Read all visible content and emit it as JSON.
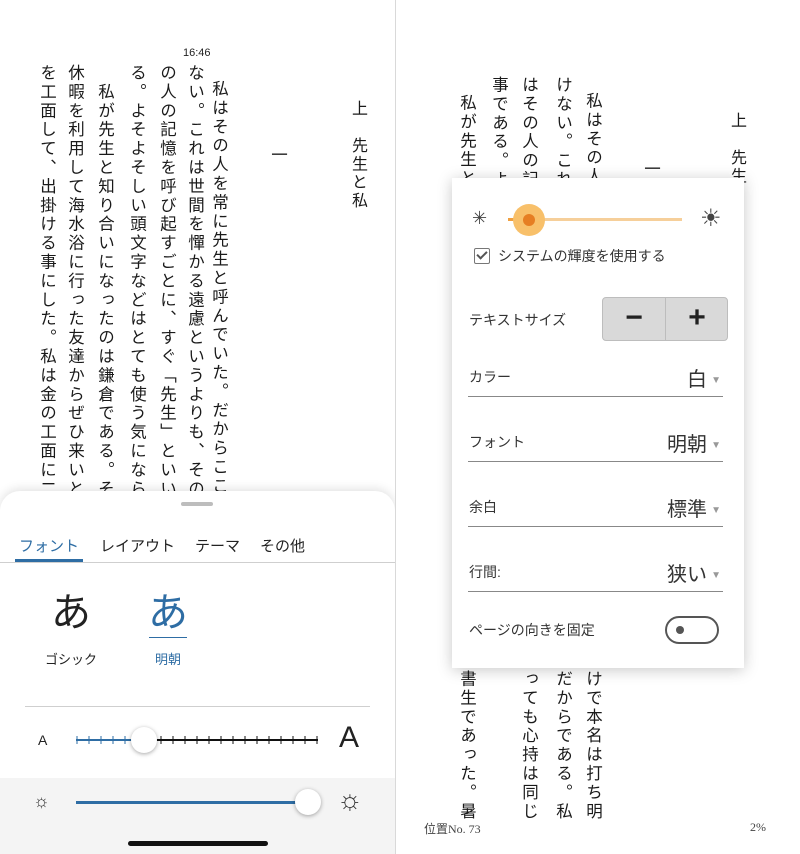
{
  "status_bar": {
    "time": "16:46"
  },
  "left_page": {
    "chapter_title": "上　先生と私",
    "section_number": "一",
    "columns": [
      "私はその人を常に先生と呼んでいた。だからここでも",
      "ない。これは世間を憚かる遠慮というよりも、その方が私",
      "の人の記憶を呼び起すごとに、すぐ「先生」といいたくな",
      "る。よそよそしい頭文字などはとても使う気にならない。",
      "　私が先生と知り合いになったのは鎌倉である。その時私",
      "休暇を利用して海水浴に行った友達からぜひ来いという",
      "を工面して、出掛ける事にした。私は金の工面に二、三日"
    ]
  },
  "reader_settings_sheet": {
    "tabs": [
      "フォント",
      "レイアウト",
      "テーマ",
      "その他"
    ],
    "active_tab": "フォント",
    "font_options": [
      {
        "glyph": "あ",
        "label": "ゴシック",
        "selected": false
      },
      {
        "glyph": "あ",
        "label": "明朝",
        "selected": true
      }
    ],
    "text_size": {
      "small_label": "A",
      "large_label": "A",
      "level": 0.28
    },
    "brightness": {
      "level": 0.96,
      "icon_low": "sun-small-icon",
      "icon_high": "sun-large-icon"
    }
  },
  "right_page": {
    "chapter_title": "上　先生",
    "section_number": "一",
    "top_columns": [
      "私はその人",
      "けない。これ",
      "はその人の記",
      "事である。よ",
      "私が先生と"
    ],
    "bottom_columns": [
      "けで本名は打ち明",
      "だからである。私",
      "っても心持は同じ",
      "書生であった。暑"
    ],
    "location_label": "位置No. 73",
    "progress_percent": "2%"
  },
  "display_settings_popup": {
    "brightness_level": 0.12,
    "use_system_brightness": {
      "label": "システムの輝度を使用する",
      "checked": true
    },
    "text_size": {
      "label": "テキストサイズ",
      "decrease": "−",
      "increase": "+"
    },
    "color": {
      "label": "カラー",
      "value": "白"
    },
    "font": {
      "label": "フォント",
      "value": "明朝"
    },
    "margin": {
      "label": "余白",
      "value": "標準"
    },
    "line_spacing": {
      "label": "行間:",
      "value": "狭い"
    },
    "orientation_lock": {
      "label": "ページの向きを固定",
      "on": false
    }
  },
  "colors": {
    "accent_blue": "#2e6da4",
    "accent_orange": "#e67e22",
    "orange_track": "#f6cf9a"
  }
}
